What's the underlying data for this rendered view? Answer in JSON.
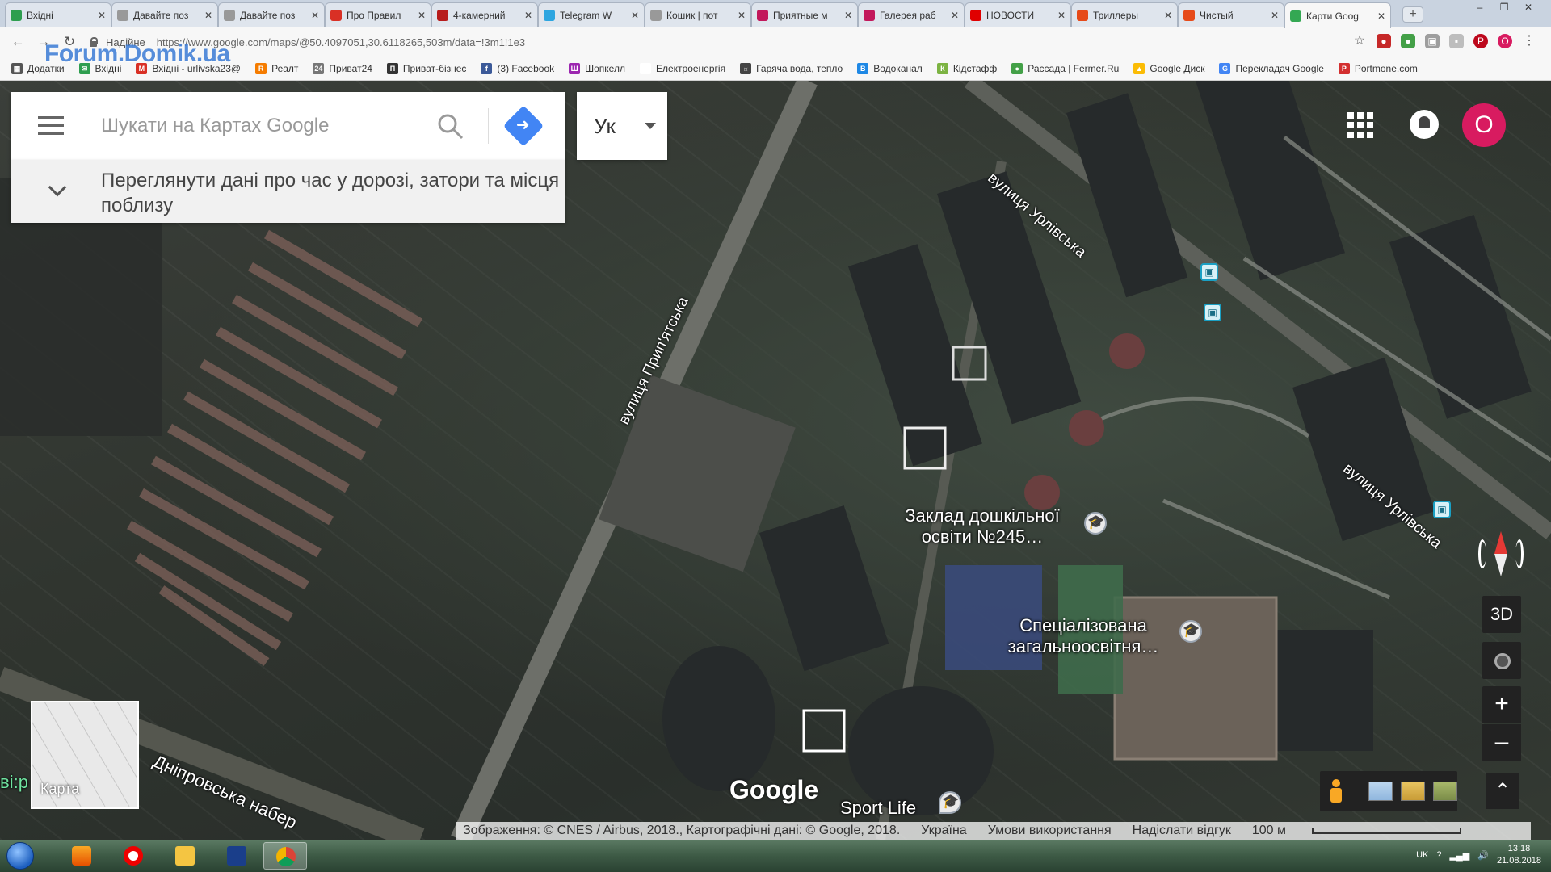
{
  "browser": {
    "tabs": [
      {
        "label": "Вхідні",
        "color": "#2e9e4f"
      },
      {
        "label": "Давайте поз",
        "color": "#999999"
      },
      {
        "label": "Давайте поз",
        "color": "#999999"
      },
      {
        "label": "Про Правил",
        "color": "#d93025"
      },
      {
        "label": "4-камерний",
        "color": "#b71c1c"
      },
      {
        "label": "Telegram W",
        "color": "#2ca5e0"
      },
      {
        "label": "Кошик | пот",
        "color": "#999999"
      },
      {
        "label": "Приятные м",
        "color": "#c2185b"
      },
      {
        "label": "Галерея раб",
        "color": "#c2185b"
      },
      {
        "label": "НОВОСТИ ",
        "color": "#e00000"
      },
      {
        "label": "Триллеры",
        "color": "#e64a19"
      },
      {
        "label": "Чистый",
        "color": "#e64a19"
      },
      {
        "label": "Карти Goog",
        "color": "#34a853"
      }
    ],
    "secure_label": "Надійне",
    "url": "https://www.google.com/maps/@50.4097051,30.6118265,503m/data=!3m1!1e3",
    "watermark": "Forum.Domik.ua",
    "bookmarks": [
      {
        "label": "Додатки",
        "color": "#555555",
        "glyph": "▦"
      },
      {
        "label": "Вхідні",
        "color": "#2e9e4f",
        "glyph": "✉"
      },
      {
        "label": "Вхідні - urlivska23@",
        "color": "#d93025",
        "glyph": "M"
      },
      {
        "label": "Реалт",
        "color": "#f57c00",
        "glyph": "R"
      },
      {
        "label": "Приват24",
        "color": "#777777",
        "glyph": "24"
      },
      {
        "label": "Приват-бізнес",
        "color": "#333333",
        "glyph": "П"
      },
      {
        "label": "(3) Facebook",
        "color": "#3b5998",
        "glyph": "f"
      },
      {
        "label": "Шопкелл",
        "color": "#9c27b0",
        "glyph": "Ш"
      },
      {
        "label": "Електроенергія",
        "color": "#ffffff",
        "glyph": ""
      },
      {
        "label": "Гаряча вода, тепло",
        "color": "#444444",
        "glyph": "☼"
      },
      {
        "label": "Водоканал",
        "color": "#1e88e5",
        "glyph": "В"
      },
      {
        "label": "Кідстафф",
        "color": "#7cb342",
        "glyph": "К"
      },
      {
        "label": "Рассада | Fermer.Ru",
        "color": "#43a047",
        "glyph": "●"
      },
      {
        "label": "Google Диск",
        "color": "#fbbc05",
        "glyph": "▲"
      },
      {
        "label": "Перекладач Google",
        "color": "#4285f4",
        "glyph": "G"
      },
      {
        "label": "Portmone.com",
        "color": "#d32f2f",
        "glyph": "P"
      }
    ]
  },
  "search": {
    "placeholder": "Шукати на Картах Google",
    "traffic_text": "Переглянути дані про час у дорозі, затори та місця поблизу"
  },
  "lang": {
    "label": "Ук"
  },
  "account": {
    "initial": "O"
  },
  "map": {
    "roads": {
      "urlivska_top": "вулиця Урлівська",
      "urlivska_right": "вулиця Урлівська",
      "prypiatska": "вулиця Прип'ятська",
      "dniprovska": "Дніпровська набер",
      "left_edge": "ві:р"
    },
    "pois": {
      "kindergarten": "Заклад дошкільної освіти №245…",
      "school": "Спеціалізована загальноосвітня…",
      "sport": "Sport Life"
    },
    "logo": "Google",
    "minimap_label": "Карта",
    "btn_3d": "3D"
  },
  "attribution": {
    "imagery": "Зображення: © CNES / Airbus, 2018., Картографічні дані: © Google, 2018.",
    "country": "Україна",
    "terms": "Умови використання",
    "feedback": "Надіслати відгук",
    "scale": "100 м"
  },
  "taskbar": {
    "lang": "UK",
    "time": "13:18",
    "date": "21.08.2018"
  }
}
